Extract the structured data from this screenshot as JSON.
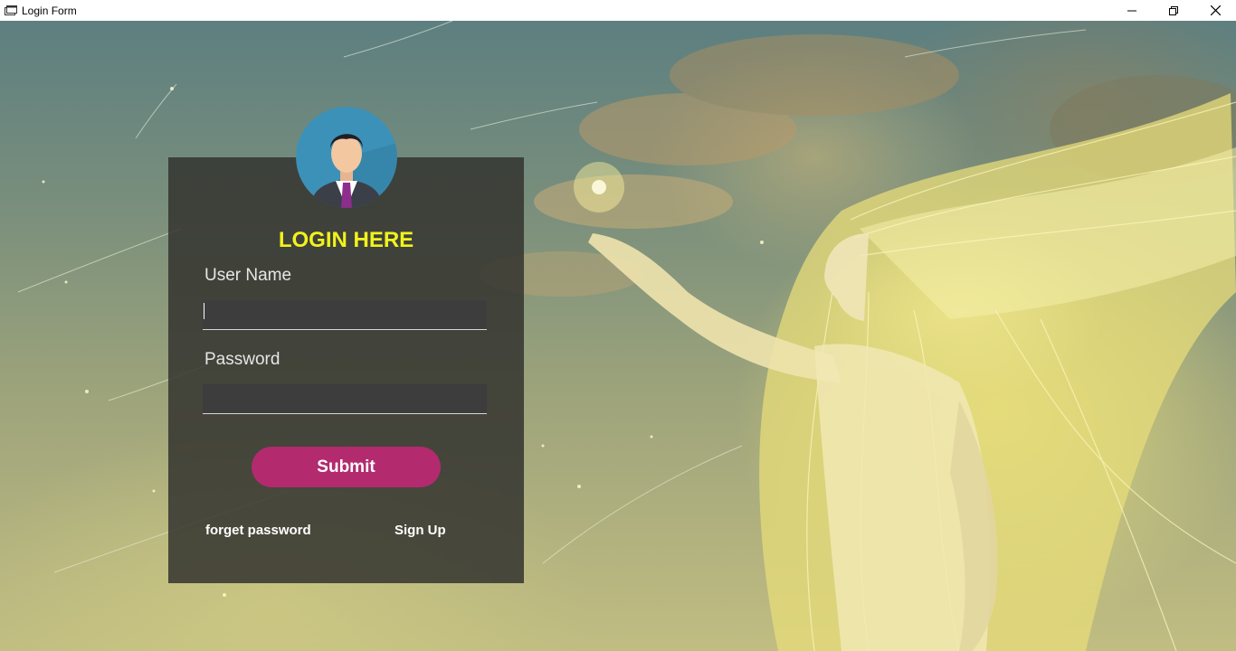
{
  "window": {
    "title": "Login Form",
    "app_icon": "form-icon",
    "controls": [
      "minimize-icon",
      "restore-icon",
      "close-icon"
    ]
  },
  "background": {
    "description_icon": "fantasy-woman-background"
  },
  "login": {
    "avatar_icon": "user-avatar-icon",
    "heading": "LOGIN HERE",
    "username_label": "User Name",
    "username_value": "",
    "password_label": "Password",
    "password_value": "",
    "submit_label": "Submit",
    "forgot_label": "forget password",
    "signup_label": "Sign Up"
  },
  "colors": {
    "heading": "#f2f21c",
    "submit_bg": "#b32a6f",
    "card_bg": "#343430",
    "input_bg": "#3d3d3d"
  }
}
